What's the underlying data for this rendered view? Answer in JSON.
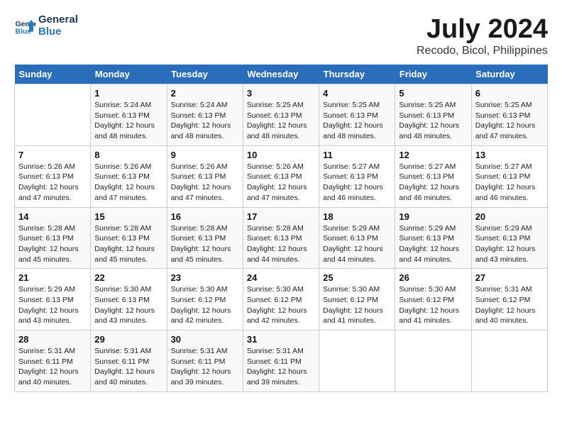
{
  "header": {
    "logo_line1": "General",
    "logo_line2": "Blue",
    "month_year": "July 2024",
    "location": "Recodo, Bicol, Philippines"
  },
  "weekdays": [
    "Sunday",
    "Monday",
    "Tuesday",
    "Wednesday",
    "Thursday",
    "Friday",
    "Saturday"
  ],
  "weeks": [
    [
      {
        "day": "",
        "info": ""
      },
      {
        "day": "1",
        "info": "Sunrise: 5:24 AM\nSunset: 6:13 PM\nDaylight: 12 hours\nand 48 minutes."
      },
      {
        "day": "2",
        "info": "Sunrise: 5:24 AM\nSunset: 6:13 PM\nDaylight: 12 hours\nand 48 minutes."
      },
      {
        "day": "3",
        "info": "Sunrise: 5:25 AM\nSunset: 6:13 PM\nDaylight: 12 hours\nand 48 minutes."
      },
      {
        "day": "4",
        "info": "Sunrise: 5:25 AM\nSunset: 6:13 PM\nDaylight: 12 hours\nand 48 minutes."
      },
      {
        "day": "5",
        "info": "Sunrise: 5:25 AM\nSunset: 6:13 PM\nDaylight: 12 hours\nand 48 minutes."
      },
      {
        "day": "6",
        "info": "Sunrise: 5:25 AM\nSunset: 6:13 PM\nDaylight: 12 hours\nand 47 minutes."
      }
    ],
    [
      {
        "day": "7",
        "info": "Sunrise: 5:26 AM\nSunset: 6:13 PM\nDaylight: 12 hours\nand 47 minutes."
      },
      {
        "day": "8",
        "info": "Sunrise: 5:26 AM\nSunset: 6:13 PM\nDaylight: 12 hours\nand 47 minutes."
      },
      {
        "day": "9",
        "info": "Sunrise: 5:26 AM\nSunset: 6:13 PM\nDaylight: 12 hours\nand 47 minutes."
      },
      {
        "day": "10",
        "info": "Sunrise: 5:26 AM\nSunset: 6:13 PM\nDaylight: 12 hours\nand 47 minutes."
      },
      {
        "day": "11",
        "info": "Sunrise: 5:27 AM\nSunset: 6:13 PM\nDaylight: 12 hours\nand 46 minutes."
      },
      {
        "day": "12",
        "info": "Sunrise: 5:27 AM\nSunset: 6:13 PM\nDaylight: 12 hours\nand 46 minutes."
      },
      {
        "day": "13",
        "info": "Sunrise: 5:27 AM\nSunset: 6:13 PM\nDaylight: 12 hours\nand 46 minutes."
      }
    ],
    [
      {
        "day": "14",
        "info": "Sunrise: 5:28 AM\nSunset: 6:13 PM\nDaylight: 12 hours\nand 45 minutes."
      },
      {
        "day": "15",
        "info": "Sunrise: 5:28 AM\nSunset: 6:13 PM\nDaylight: 12 hours\nand 45 minutes."
      },
      {
        "day": "16",
        "info": "Sunrise: 5:28 AM\nSunset: 6:13 PM\nDaylight: 12 hours\nand 45 minutes."
      },
      {
        "day": "17",
        "info": "Sunrise: 5:28 AM\nSunset: 6:13 PM\nDaylight: 12 hours\nand 44 minutes."
      },
      {
        "day": "18",
        "info": "Sunrise: 5:29 AM\nSunset: 6:13 PM\nDaylight: 12 hours\nand 44 minutes."
      },
      {
        "day": "19",
        "info": "Sunrise: 5:29 AM\nSunset: 6:13 PM\nDaylight: 12 hours\nand 44 minutes."
      },
      {
        "day": "20",
        "info": "Sunrise: 5:29 AM\nSunset: 6:13 PM\nDaylight: 12 hours\nand 43 minutes."
      }
    ],
    [
      {
        "day": "21",
        "info": "Sunrise: 5:29 AM\nSunset: 6:13 PM\nDaylight: 12 hours\nand 43 minutes."
      },
      {
        "day": "22",
        "info": "Sunrise: 5:30 AM\nSunset: 6:13 PM\nDaylight: 12 hours\nand 43 minutes."
      },
      {
        "day": "23",
        "info": "Sunrise: 5:30 AM\nSunset: 6:12 PM\nDaylight: 12 hours\nand 42 minutes."
      },
      {
        "day": "24",
        "info": "Sunrise: 5:30 AM\nSunset: 6:12 PM\nDaylight: 12 hours\nand 42 minutes."
      },
      {
        "day": "25",
        "info": "Sunrise: 5:30 AM\nSunset: 6:12 PM\nDaylight: 12 hours\nand 41 minutes."
      },
      {
        "day": "26",
        "info": "Sunrise: 5:30 AM\nSunset: 6:12 PM\nDaylight: 12 hours\nand 41 minutes."
      },
      {
        "day": "27",
        "info": "Sunrise: 5:31 AM\nSunset: 6:12 PM\nDaylight: 12 hours\nand 40 minutes."
      }
    ],
    [
      {
        "day": "28",
        "info": "Sunrise: 5:31 AM\nSunset: 6:11 PM\nDaylight: 12 hours\nand 40 minutes."
      },
      {
        "day": "29",
        "info": "Sunrise: 5:31 AM\nSunset: 6:11 PM\nDaylight: 12 hours\nand 40 minutes."
      },
      {
        "day": "30",
        "info": "Sunrise: 5:31 AM\nSunset: 6:11 PM\nDaylight: 12 hours\nand 39 minutes."
      },
      {
        "day": "31",
        "info": "Sunrise: 5:31 AM\nSunset: 6:11 PM\nDaylight: 12 hours\nand 39 minutes."
      },
      {
        "day": "",
        "info": ""
      },
      {
        "day": "",
        "info": ""
      },
      {
        "day": "",
        "info": ""
      }
    ]
  ]
}
